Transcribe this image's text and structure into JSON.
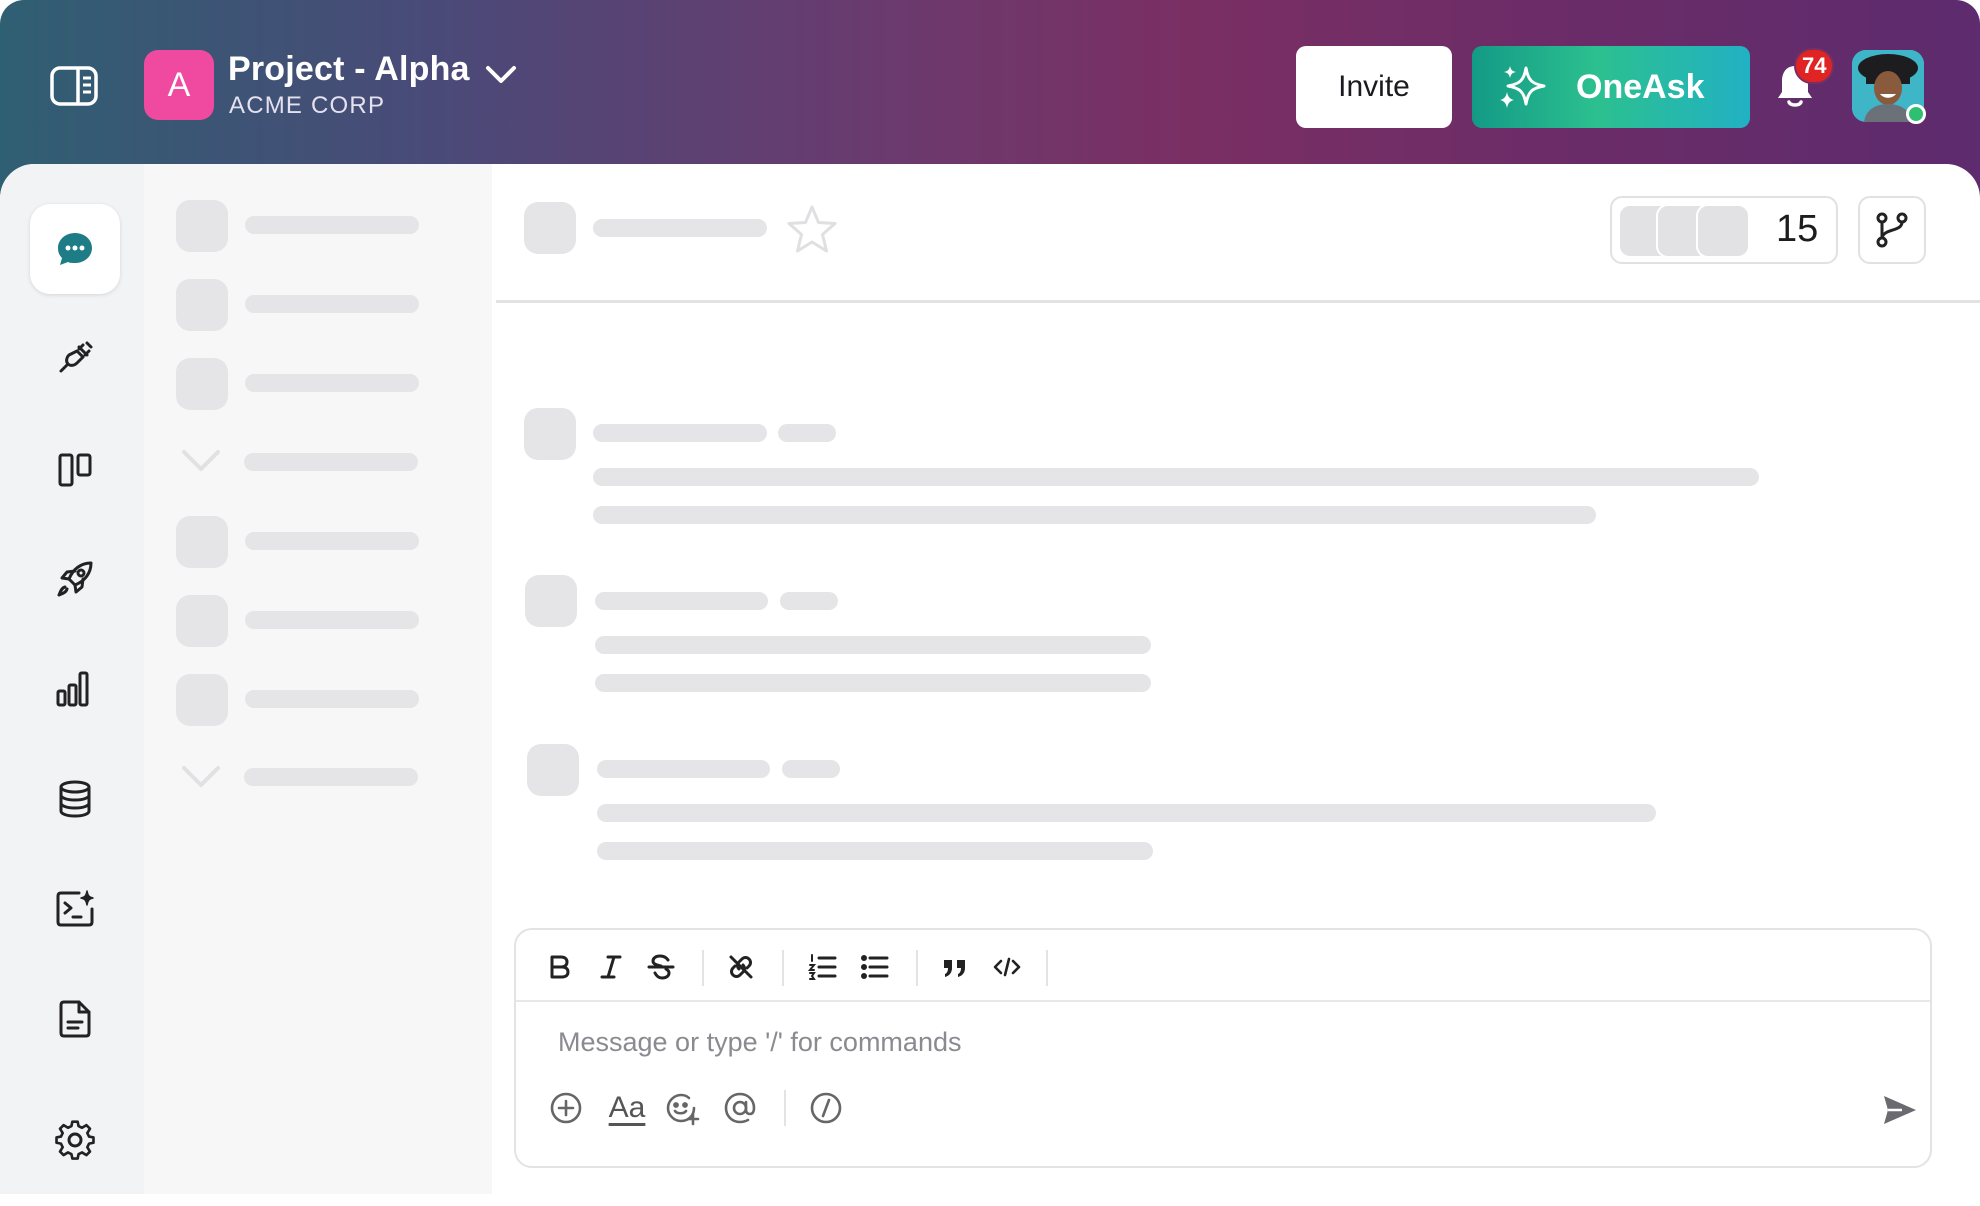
{
  "workspace": {
    "avatar_letter": "A",
    "name": "Project - Alpha",
    "org": "ACME CORP"
  },
  "header": {
    "invite_label": "Invite",
    "oneask_label": "OneAsk",
    "notification_count": "74"
  },
  "channel": {
    "member_count": "15"
  },
  "composer": {
    "placeholder": "Message or type '/' for commands",
    "format_label": "Aa"
  },
  "rail": {
    "items": [
      "chat-icon",
      "plug-icon",
      "board-icon",
      "rocket-icon",
      "chart-icon",
      "database-icon",
      "terminal-sparkle-icon",
      "document-icon",
      "settings-icon"
    ],
    "active": "chat-icon"
  },
  "colors": {
    "workspace_avatar": "#f04aa0",
    "oneask_gradient_start": "#139a86",
    "oneask_gradient_end": "#21b1c4",
    "badge": "#e02424",
    "chat_active": "#1e7c86",
    "online": "#2fbf71"
  }
}
